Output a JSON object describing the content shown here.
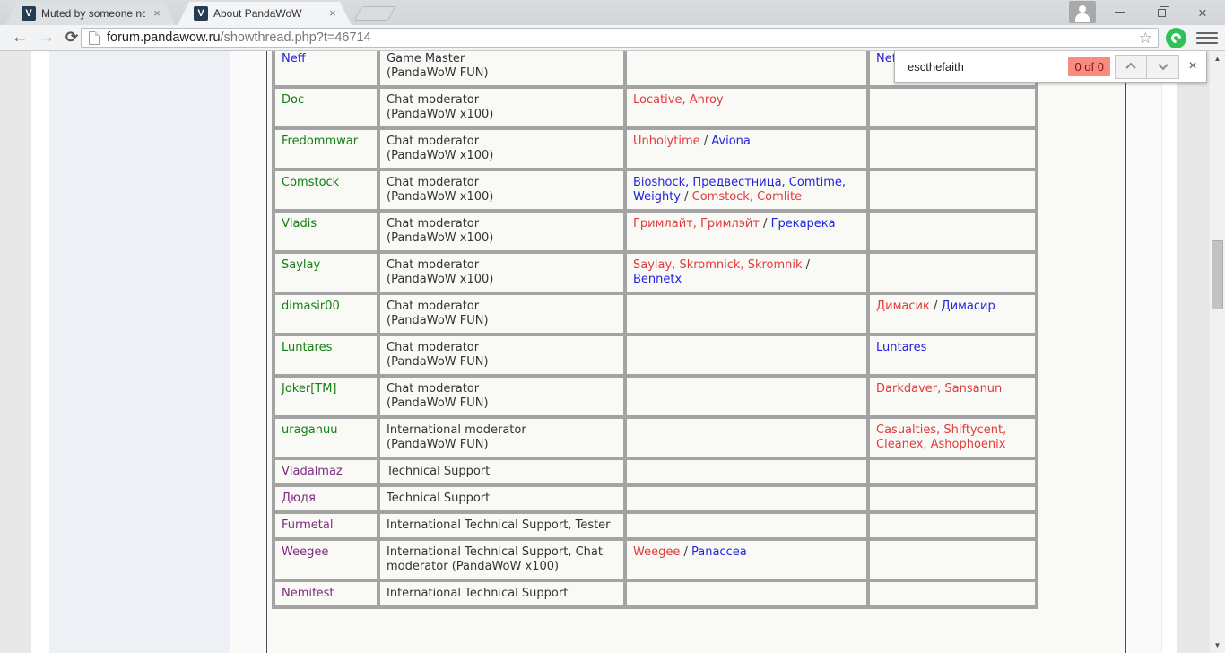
{
  "colors": {
    "link_blue": "#2323dd",
    "link_red": "#e03c3c",
    "name_green": "#128012",
    "name_purple": "#7d2b7d",
    "text": "#333333",
    "badge_bg": "#fa8b80",
    "badge_text": "#7d1414"
  },
  "icons": {
    "back": "←",
    "forward": "→",
    "reload": "⟳",
    "star": "☆",
    "close": "×",
    "scroll_up": "▲",
    "scroll_down": "▼",
    "favicon_letter": "V"
  },
  "browser": {
    "tabs": [
      {
        "title": "Muted by someone not o"
      },
      {
        "title": "About PandaWoW"
      }
    ],
    "omnibox": {
      "domain": "forum.pandawow.ru",
      "path": "/showthread.php?t=46714"
    }
  },
  "findbar": {
    "query": "escthefaith",
    "matches": "0 of 0"
  },
  "table": {
    "rows": [
      {
        "name": "Neff",
        "name_color": "blue",
        "tall": true,
        "role": [
          "Game Master",
          "(PandaWoW FUN)"
        ],
        "col3": [],
        "col4": [
          {
            "t": "Neff",
            "c": "blue"
          }
        ]
      },
      {
        "name": "Doc",
        "name_color": "green",
        "tall": true,
        "role": [
          "Chat moderator",
          "(PandaWoW x100)"
        ],
        "col3": [
          {
            "t": "Locative, Anroy",
            "c": "red"
          }
        ],
        "col4": []
      },
      {
        "name": "Fredommwar",
        "name_color": "green",
        "tall": true,
        "role": [
          "Chat moderator",
          "(PandaWoW x100)"
        ],
        "col3": [
          {
            "t": "Unholytime",
            "c": "red"
          },
          {
            "t": " / ",
            "c": "plain"
          },
          {
            "t": "Aviona",
            "c": "blue"
          }
        ],
        "col4": []
      },
      {
        "name": "Comstock",
        "name_color": "green",
        "tall": true,
        "role": [
          "Chat moderator",
          "(PandaWoW x100)"
        ],
        "col3": [
          {
            "t": "Bioshock, Предвестница, Comtime, Weighty",
            "c": "blue"
          },
          {
            "t": " / ",
            "c": "plain"
          },
          {
            "t": "Comstock, Comlite",
            "c": "red"
          }
        ],
        "col4": []
      },
      {
        "name": "Vladis",
        "name_color": "green",
        "tall": true,
        "role": [
          "Chat moderator",
          "(PandaWoW x100)"
        ],
        "col3": [
          {
            "t": "Гримлайт, Гримлэйт",
            "c": "red"
          },
          {
            "t": " / ",
            "c": "plain"
          },
          {
            "t": "Грекарека",
            "c": "blue"
          }
        ],
        "col4": []
      },
      {
        "name": "Saylay",
        "name_color": "green",
        "tall": true,
        "role": [
          "Chat moderator",
          "(PandaWoW x100)"
        ],
        "col3": [
          {
            "t": "Saylay, Skromnick, Skromnik",
            "c": "red"
          },
          {
            "t": " / ",
            "c": "plain"
          },
          {
            "t": "Bennetx",
            "c": "blue"
          }
        ],
        "col4": []
      },
      {
        "name": "dimasir00",
        "name_color": "green",
        "tall": true,
        "role": [
          "Chat moderator",
          "(PandaWoW FUN)"
        ],
        "col3": [],
        "col4": [
          {
            "t": "Димасик",
            "c": "red"
          },
          {
            "t": " / ",
            "c": "plain"
          },
          {
            "t": "Димасир",
            "c": "blue"
          }
        ]
      },
      {
        "name": "Luntares",
        "name_color": "green",
        "tall": true,
        "role": [
          "Chat moderator",
          "(PandaWoW FUN)"
        ],
        "col3": [],
        "col4": [
          {
            "t": "Luntares",
            "c": "blue"
          }
        ]
      },
      {
        "name": "Joker[TM]",
        "name_color": "green",
        "tall": true,
        "role": [
          "Chat moderator",
          "(PandaWoW FUN)"
        ],
        "col3": [],
        "col4": [
          {
            "t": "Darkdaver, Sansanun",
            "c": "red"
          }
        ]
      },
      {
        "name": "uraganuu",
        "name_color": "green",
        "tall": true,
        "role": [
          "International moderator",
          "(PandaWoW FUN)"
        ],
        "col3": [],
        "col4": [
          {
            "t": "Casualties, Shiftycent, Cleanex, Ashophoenix",
            "c": "red"
          }
        ]
      },
      {
        "name": "Vladalmaz",
        "name_color": "purple",
        "tall": false,
        "role": [
          "Technical Support"
        ],
        "col3": [],
        "col4": []
      },
      {
        "name": "Дюдя",
        "name_color": "purple",
        "tall": false,
        "role": [
          "Technical Support"
        ],
        "col3": [],
        "col4": []
      },
      {
        "name": "Furmetal",
        "name_color": "purple",
        "tall": false,
        "role": [
          "International Technical Support, Tester"
        ],
        "col3": [],
        "col4": []
      },
      {
        "name": "Weegee",
        "name_color": "purple",
        "tall": true,
        "role": [
          "International Technical Support, Chat moderator (PandaWoW x100)"
        ],
        "col3": [
          {
            "t": "Weegee",
            "c": "red"
          },
          {
            "t": " / ",
            "c": "plain"
          },
          {
            "t": "Panaccea",
            "c": "blue"
          }
        ],
        "col4": []
      },
      {
        "name": "Nemifest",
        "name_color": "purple",
        "tall": false,
        "role": [
          "International Technical Support"
        ],
        "col3": [],
        "col4": []
      }
    ]
  }
}
